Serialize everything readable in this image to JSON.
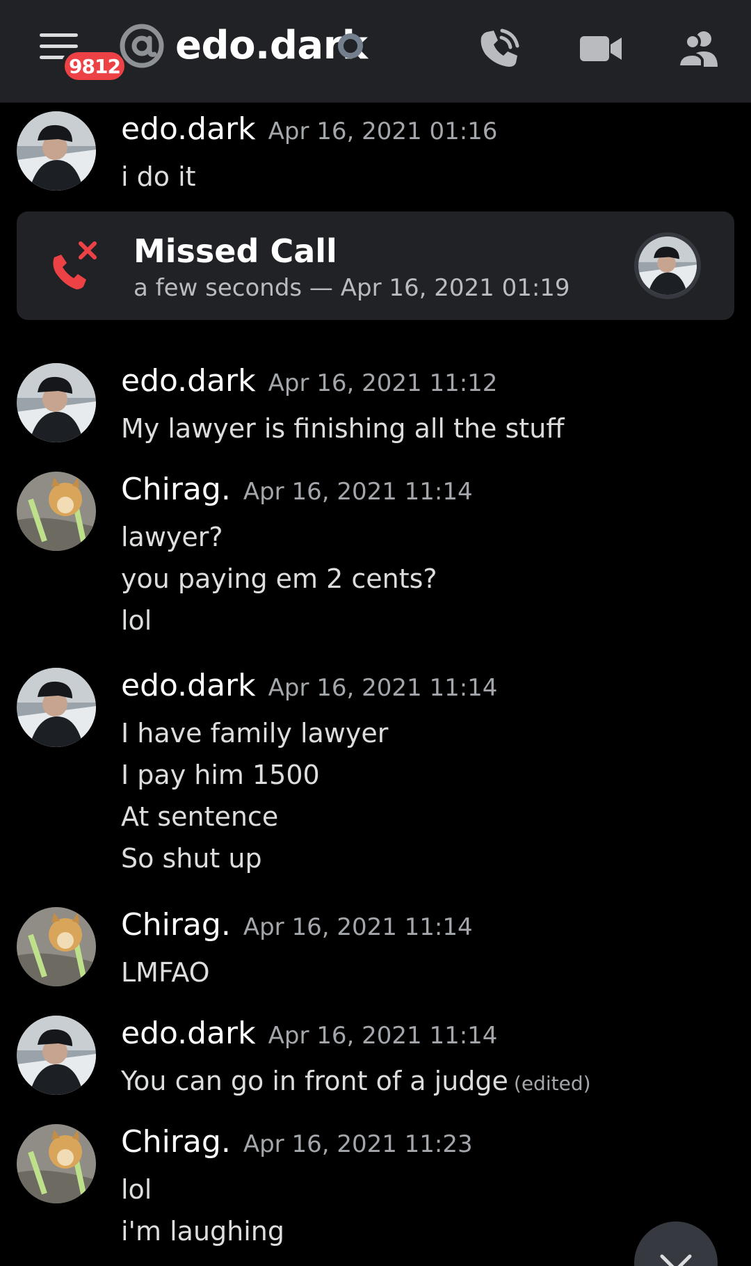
{
  "header": {
    "notification_count": "9812",
    "title": "edo.dark",
    "icons": [
      "menu-icon",
      "at-icon",
      "call-icon",
      "video-icon",
      "members-icon"
    ]
  },
  "messages": [
    {
      "author": "edo.dark",
      "timestamp": "Apr 16, 2021 01:16",
      "lines": [
        "i do it"
      ],
      "avatar": "edo"
    },
    {
      "author": "edo.dark",
      "timestamp": "Apr 16, 2021 11:12",
      "lines": [
        "My lawyer is finishing all the stuff"
      ],
      "avatar": "edo"
    },
    {
      "author": "Chirag.",
      "timestamp": "Apr 16, 2021 11:14",
      "lines": [
        "lawyer?",
        "you paying em 2 cents?",
        "lol"
      ],
      "avatar": "doge"
    },
    {
      "author": "edo.dark",
      "timestamp": "Apr 16, 2021 11:14",
      "lines": [
        "I have family lawyer",
        "I pay him 1500",
        "At sentence",
        "So shut up"
      ],
      "avatar": "edo"
    },
    {
      "author": "Chirag.",
      "timestamp": "Apr 16, 2021 11:14",
      "lines": [
        "LMFAO"
      ],
      "avatar": "doge"
    },
    {
      "author": "edo.dark",
      "timestamp": "Apr 16, 2021 11:14",
      "lines": [
        "You can go in front of a judge"
      ],
      "edited": "(edited)",
      "avatar": "edo"
    },
    {
      "author": "Chirag.",
      "timestamp": "Apr 16, 2021 11:23",
      "lines": [
        "lol",
        "i'm laughing"
      ],
      "avatar": "doge"
    }
  ],
  "missed_call": {
    "title": "Missed Call",
    "subtitle": "a few seconds — Apr 16, 2021 01:19"
  },
  "colors": {
    "background": "#000000",
    "header": "#202225",
    "card": "#202225",
    "danger": "#ed4245",
    "status_offline": "#747f8d"
  }
}
